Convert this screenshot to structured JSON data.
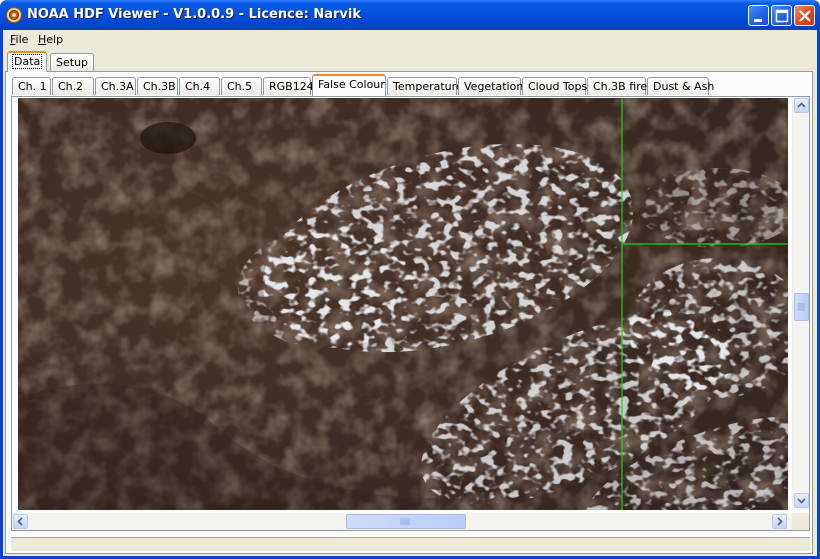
{
  "window": {
    "title": "NOAA HDF Viewer - V1.0.0.9 - Licence: Narvik",
    "icons": {
      "app": "satellite-dish-icon",
      "minimize": "minimize-icon",
      "maximize": "maximize-icon",
      "close": "close-icon"
    }
  },
  "menu": {
    "file": {
      "accel": "F",
      "rest": "ile"
    },
    "help": {
      "accel": "H",
      "rest": "elp"
    }
  },
  "outer_tabs": [
    {
      "label": "Data",
      "active": true
    },
    {
      "label": "Setup",
      "active": false
    }
  ],
  "channel_tabs": [
    {
      "label": "Ch. 1"
    },
    {
      "label": "Ch.2"
    },
    {
      "label": "Ch.3A"
    },
    {
      "label": "Ch.3B"
    },
    {
      "label": "Ch.4"
    },
    {
      "label": "Ch.5"
    },
    {
      "label": "RGB124"
    },
    {
      "label": "False Colour",
      "active": true
    },
    {
      "label": "Temperature"
    },
    {
      "label": "Vegetation"
    },
    {
      "label": "Cloud Tops"
    },
    {
      "label": "Ch.3B fire"
    },
    {
      "label": "Dust & Ash"
    }
  ],
  "image": {
    "description_colors": {
      "ground": "#3b2a22",
      "cloud": "#cfd8e0",
      "grid_line": "#19d219"
    }
  },
  "scrollbars": {
    "vertical": {
      "position_fraction": 0.5
    },
    "horizontal": {
      "position_fraction": 0.5
    }
  },
  "colors": {
    "title_bar": "#0553e0",
    "active_tab_accent": "#e68b2c",
    "client_bg": "#ece9d8"
  }
}
